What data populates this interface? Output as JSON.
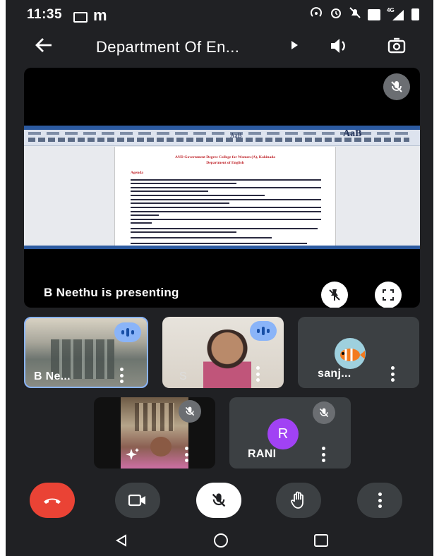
{
  "status_bar": {
    "time": "11:35",
    "left_icon_letter": "m",
    "right_icons": [
      "hotspot-icon",
      "alarm-icon",
      "mute-icon",
      "volte-icon",
      "signal-4g-icon",
      "battery-icon"
    ],
    "network_label": "4G"
  },
  "header": {
    "title": "Department Of En...",
    "back_icon": "arrow-left-icon",
    "title_icon": "chevron-right-icon",
    "speaker_icon": "speaker-icon",
    "camera_switch_icon": "camera-switch-icon"
  },
  "presentation": {
    "presenter_text": "B Neethu is presenting",
    "doc_title_line1": "AND Government Degree College for Women (A), Kakinada",
    "doc_title_line2": "Department of English",
    "doc_agenda": "Agenda",
    "toolbar_style_sample": "AaB"
  },
  "participants": [
    {
      "name": "B Ne...",
      "state": "speaking"
    },
    {
      "name": "S",
      "state": "speaking"
    },
    {
      "name": "sanj...",
      "state": "avatar"
    },
    {
      "name": "",
      "state": "muted-video"
    },
    {
      "name": "RANI",
      "initial": "R",
      "state": "muted-avatar"
    }
  ],
  "controls": {
    "end_call_icon": "end-call-icon",
    "camera_icon": "video-camera-icon",
    "mic_icon": "mic-off-icon",
    "hand_icon": "raise-hand-icon",
    "more_icon": "more-vertical-icon"
  },
  "colors": {
    "background": "#202124",
    "end_call": "#ea4335",
    "control_bg": "#3c4043",
    "speaking": "#8ab4f8",
    "rani_avatar": "#a142f4"
  }
}
